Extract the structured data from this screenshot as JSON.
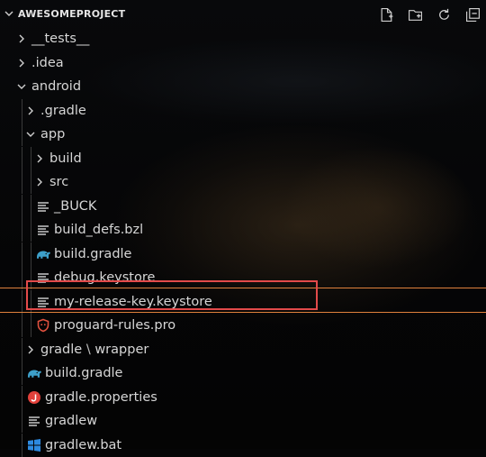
{
  "explorer": {
    "title": "AWESOMEPROJECT",
    "actions": [
      {
        "name": "new-file-icon"
      },
      {
        "name": "new-folder-icon"
      },
      {
        "name": "refresh-icon"
      },
      {
        "name": "collapse-all-icon"
      }
    ]
  },
  "tree": [
    {
      "label": "__tests__",
      "type": "folder",
      "depth": 0,
      "expanded": false
    },
    {
      "label": ".idea",
      "type": "folder",
      "depth": 0,
      "expanded": false
    },
    {
      "label": "android",
      "type": "folder",
      "depth": 0,
      "expanded": true
    },
    {
      "label": ".gradle",
      "type": "folder",
      "depth": 1,
      "expanded": false
    },
    {
      "label": "app",
      "type": "folder",
      "depth": 1,
      "expanded": true
    },
    {
      "label": "build",
      "type": "folder",
      "depth": 2,
      "expanded": false
    },
    {
      "label": "src",
      "type": "folder",
      "depth": 2,
      "expanded": false
    },
    {
      "label": "_BUCK",
      "type": "file",
      "icon": "text-file-icon",
      "depth": 2
    },
    {
      "label": "build_defs.bzl",
      "type": "file",
      "icon": "text-file-icon",
      "depth": 2
    },
    {
      "label": "build.gradle",
      "type": "file",
      "icon": "gradle-elephant-icon",
      "depth": 2
    },
    {
      "label": "debug.keystore",
      "type": "file",
      "icon": "text-file-icon",
      "depth": 2
    },
    {
      "label": "my-release-key.keystore",
      "type": "file",
      "icon": "text-file-icon",
      "depth": 2,
      "highlighted": true
    },
    {
      "label": "proguard-rules.pro",
      "type": "file",
      "icon": "proguard-icon",
      "depth": 2
    },
    {
      "label": "gradle",
      "type": "folder",
      "depth": 1,
      "expanded": false,
      "compact_suffix": "wrapper"
    },
    {
      "label": "build.gradle",
      "type": "file",
      "icon": "gradle-elephant-icon",
      "depth": 1
    },
    {
      "label": "gradle.properties",
      "type": "file",
      "icon": "java-properties-icon",
      "depth": 1
    },
    {
      "label": "gradlew",
      "type": "file",
      "icon": "text-file-icon",
      "depth": 1
    },
    {
      "label": "gradlew.bat",
      "type": "file",
      "icon": "windows-icon",
      "depth": 1
    }
  ],
  "colors": {
    "highlight_border": "#e24a4a",
    "guide_line": "#e0813c",
    "gradle": "#3d9fc9",
    "proguard": "#e0513f",
    "java": "#e2413b",
    "windows": "#2d8ae0"
  }
}
